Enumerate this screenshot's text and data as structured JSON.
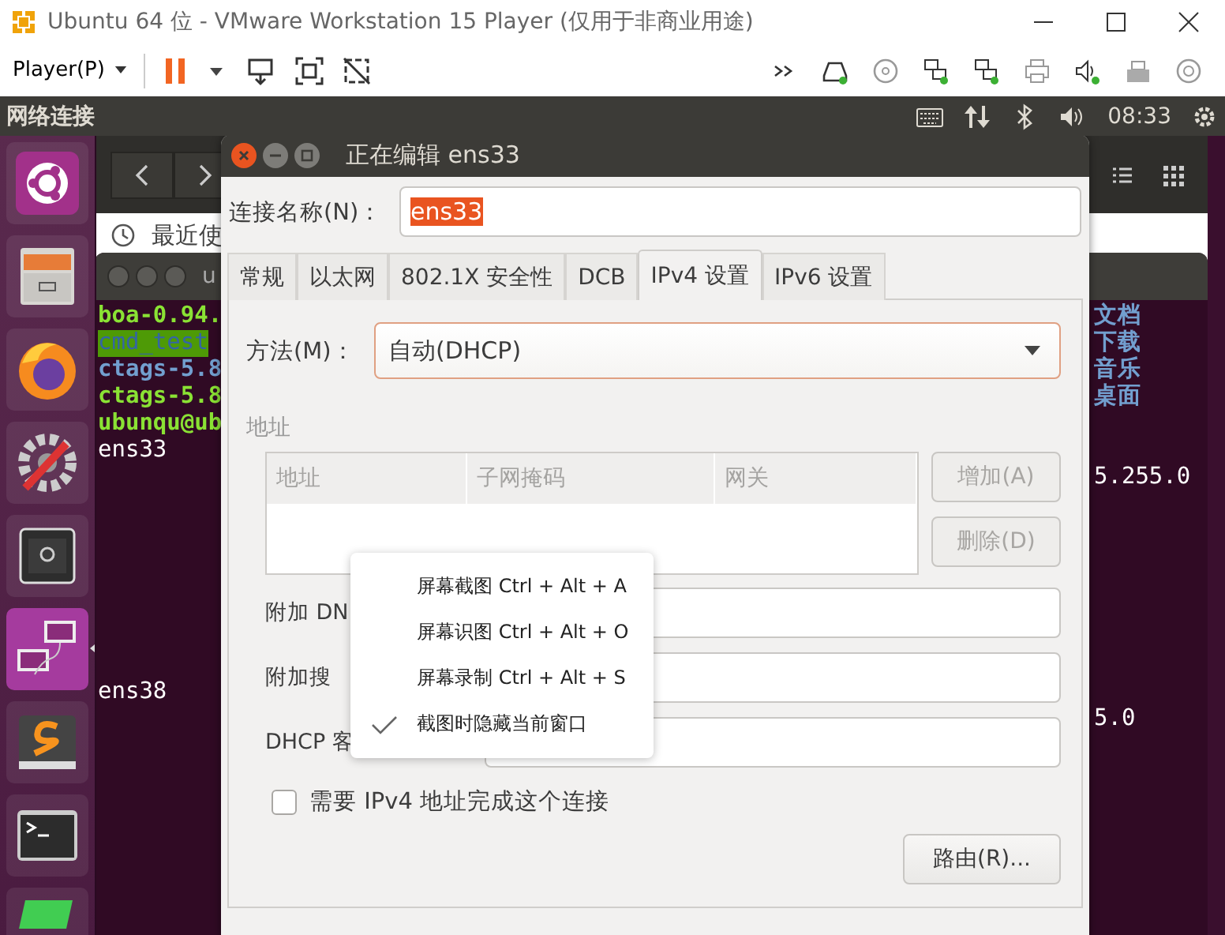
{
  "vm_window": {
    "title": "Ubuntu 64 位 - VMware Workstation 15 Player (仅用于非商业用途)",
    "player_menu": "Player(P)"
  },
  "top_panel": {
    "title": "网络连接",
    "clock": "08:33"
  },
  "launcher": {
    "items": [
      {
        "kind": "ubuntu",
        "focused": false
      },
      {
        "kind": "files",
        "focused": false
      },
      {
        "kind": "browser",
        "focused": false
      },
      {
        "kind": "settings",
        "focused": false
      },
      {
        "kind": "safe",
        "focused": false
      },
      {
        "kind": "network",
        "focused": true
      },
      {
        "kind": "editor",
        "focused": false
      },
      {
        "kind": "terminal",
        "focused": false
      },
      {
        "kind": "qt",
        "focused": false
      }
    ]
  },
  "files_window": {
    "recent_label": "最近使"
  },
  "terminal": {
    "title": "u",
    "rows": [
      {
        "left": {
          "text": "boa-0.94.",
          "kind": "exec"
        },
        "right": {
          "text": "文档",
          "kind": "dir"
        }
      },
      {
        "left": {
          "text": "cmd_test",
          "kind": "marked"
        },
        "right": {
          "text": "下载",
          "kind": "dir"
        }
      },
      {
        "left": {
          "text": "ctags-5.8",
          "kind": "dir"
        },
        "right": {
          "text": "音乐",
          "kind": "dir"
        }
      },
      {
        "left": {
          "text": "ctags-5.8",
          "kind": "exec"
        },
        "right": {
          "text": "桌面",
          "kind": "dir"
        }
      },
      {
        "left": {
          "text": "ubunqu@ub",
          "kind": "prompt"
        }
      },
      {
        "left": {
          "text": "ens33",
          "kind": "plain"
        }
      },
      {
        "right": {
          "text": "5.255.0",
          "kind": "plain"
        }
      },
      {},
      {},
      {},
      {},
      {},
      {},
      {},
      {
        "left": {
          "text": "ens38",
          "kind": "plain"
        }
      },
      {
        "right": {
          "text": "5.0",
          "kind": "plain"
        }
      }
    ]
  },
  "dialog": {
    "title": "正在编辑 ens33",
    "name_label": "连接名称(N)：",
    "name_value": "ens33",
    "tabs": [
      {
        "label": "常规",
        "selected": false
      },
      {
        "label": "以太网",
        "selected": false
      },
      {
        "label": "802.1X 安全性",
        "selected": false
      },
      {
        "label": "DCB",
        "selected": false
      },
      {
        "label": "IPv4 设置",
        "selected": true
      },
      {
        "label": "IPv6 设置",
        "selected": false
      }
    ],
    "method": {
      "label": "方法(M)：",
      "value": "自动(DHCP)"
    },
    "address_heading": "地址",
    "address_columns": [
      "地址",
      "子网掩码",
      "网关"
    ],
    "address_buttons": [
      {
        "label": "增加(A)",
        "disabled": true
      },
      {
        "label": "删除(D)",
        "disabled": true
      }
    ],
    "fields": [
      {
        "label": "附加 DN"
      },
      {
        "label": "附加搜"
      },
      {
        "label": "DHCP 客"
      }
    ],
    "require_ipv4": {
      "label": "需要 IPv4 地址完成这个连接",
      "checked": false
    },
    "routes_button": "路由(R)..."
  },
  "context_menu": {
    "items": [
      {
        "label": "屏幕截图 Ctrl + Alt + A",
        "checked": false
      },
      {
        "label": "屏幕识图 Ctrl + Alt + O",
        "checked": false
      },
      {
        "label": "屏幕录制 Ctrl + Alt + S",
        "checked": false
      },
      {
        "label": "截图时隐藏当前窗口",
        "checked": true
      }
    ]
  }
}
